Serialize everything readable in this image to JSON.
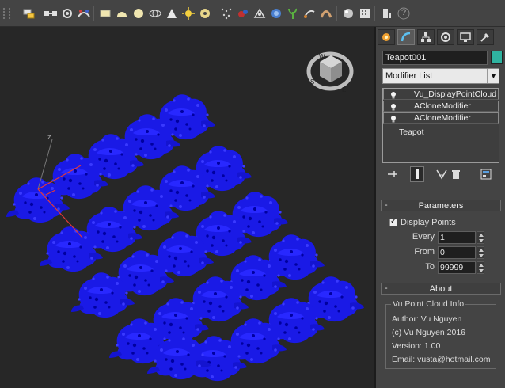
{
  "toolbar": {
    "icons": [
      "select-filter-icon",
      "link-icon",
      "unlink-icon",
      "bind-spacewarp-icon",
      "box-icon",
      "sphere-icon",
      "geosphere-icon",
      "cone-icon",
      "pyramid-icon",
      "sun-icon",
      "torus-icon",
      "particles-icon",
      "mass-fx-icon",
      "reaction-icon",
      "ragdoll-icon",
      "plant-icon",
      "tube-icon",
      "walls-icon",
      "render-setup-icon",
      "render-frame-icon",
      "help-icon"
    ],
    "help_symbol": "?"
  },
  "viewport": {
    "axis_label": "z",
    "viewcube_letters": [
      "W",
      "S",
      "E"
    ]
  },
  "panel": {
    "object_name": "Teapot001",
    "object_color": "#2fb3a0",
    "modifier_list": "Modifier List",
    "stack": [
      "Vu_DisplayPointCloud",
      "ACloneModifier",
      "ACloneModifier"
    ],
    "base_object": "Teapot",
    "parameters": {
      "title": "Parameters",
      "display_points_label": "Display Points",
      "display_points_checked": true,
      "every_label": "Every",
      "every_value": "1",
      "from_label": "From",
      "from_value": "0",
      "to_label": "To",
      "to_value": "99999"
    },
    "about": {
      "title": "About",
      "group_label": "Vu Point Cloud Info",
      "author": "Author: Vu Nguyen",
      "copyright": "(c) Vu Nguyen 2016",
      "version": "Version: 1.00",
      "email": "Email: vusta@hotmail.com"
    },
    "rollout_sign": "-"
  }
}
